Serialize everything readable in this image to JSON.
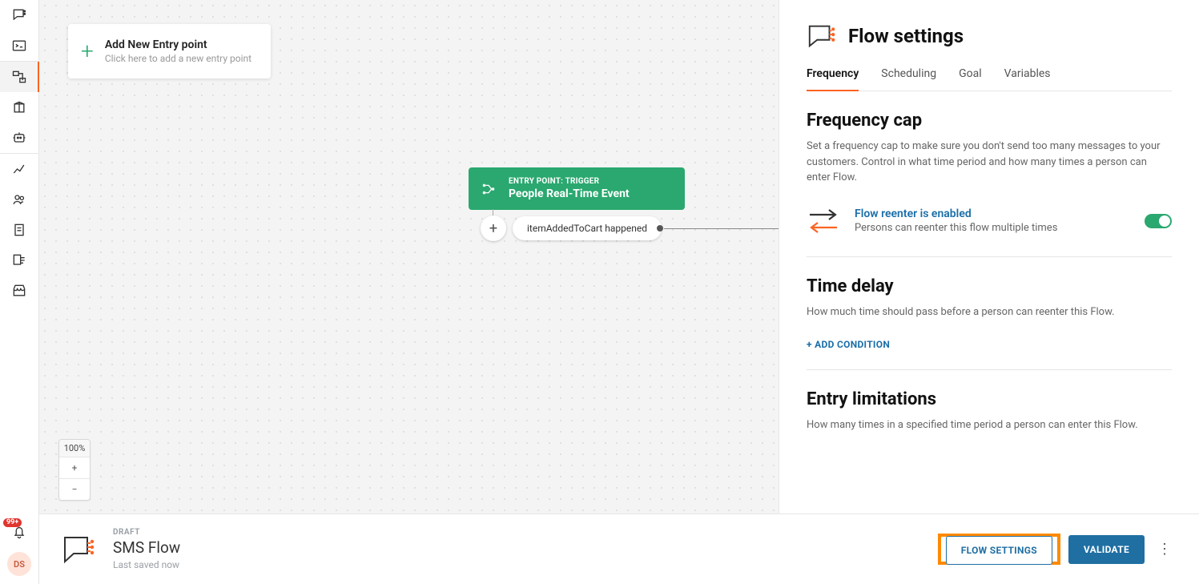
{
  "rail": {
    "badge": "99+",
    "avatar": "DS"
  },
  "canvas": {
    "entry_card": {
      "title": "Add New Entry point",
      "subtitle": "Click here to add a new entry point"
    },
    "trigger": {
      "label": "ENTRY POINT: TRIGGER",
      "title": "People Real-Time Event"
    },
    "child": "itemAddedToCart happened",
    "zoom": {
      "level": "100%",
      "plus": "+",
      "minus": "−"
    }
  },
  "panel": {
    "title": "Flow settings",
    "tabs": [
      "Frequency",
      "Scheduling",
      "Goal",
      "Variables"
    ],
    "freq": {
      "title": "Frequency cap",
      "desc": "Set a frequency cap to make sure you don't send too many messages to your customers. Control in what time period and how many times a person can enter Flow."
    },
    "reenter": {
      "title": "Flow reenter is enabled",
      "sub": "Persons can reenter this flow multiple times"
    },
    "delay": {
      "title": "Time delay",
      "desc": "How much time should pass before a person can reenter this Flow."
    },
    "add_condition": "+ ADD CONDITION",
    "entry_lim": {
      "title": "Entry limitations",
      "desc": "How many times in a specified time period a person can enter this Flow."
    }
  },
  "footer": {
    "status": "DRAFT",
    "title": "SMS Flow",
    "saved": "Last saved now",
    "settings_btn": "FLOW SETTINGS",
    "validate_btn": "VALIDATE"
  }
}
